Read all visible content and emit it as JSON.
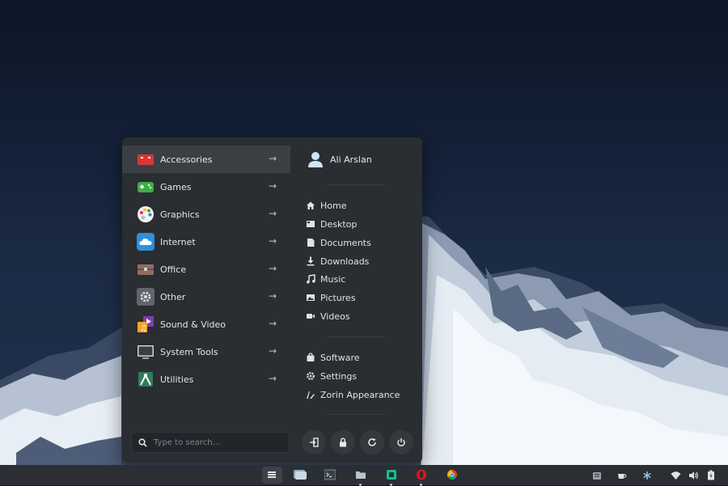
{
  "menu": {
    "categories": [
      {
        "label": "Accessories",
        "icon": "accessories-icon",
        "active": true
      },
      {
        "label": "Games",
        "icon": "games-icon"
      },
      {
        "label": "Graphics",
        "icon": "graphics-palette-icon"
      },
      {
        "label": "Internet",
        "icon": "internet-cloud-icon"
      },
      {
        "label": "Office",
        "icon": "office-briefcase-icon"
      },
      {
        "label": "Other",
        "icon": "gear-icon"
      },
      {
        "label": "Sound & Video",
        "icon": "sound-video-icon"
      },
      {
        "label": "System Tools",
        "icon": "monitor-icon"
      },
      {
        "label": "Utilities",
        "icon": "utilities-icon"
      }
    ],
    "search_placeholder": "Type to search...",
    "user": {
      "name": "Ali Arslan",
      "icon": "user-icon"
    },
    "places": [
      {
        "label": "Home",
        "icon": "home-icon"
      },
      {
        "label": "Desktop",
        "icon": "desktop-icon"
      },
      {
        "label": "Documents",
        "icon": "document-icon"
      },
      {
        "label": "Downloads",
        "icon": "download-icon"
      },
      {
        "label": "Music",
        "icon": "music-note-icon"
      },
      {
        "label": "Pictures",
        "icon": "picture-icon"
      },
      {
        "label": "Videos",
        "icon": "video-camera-icon"
      }
    ],
    "system": [
      {
        "label": "Software",
        "icon": "software-bag-icon"
      },
      {
        "label": "Settings",
        "icon": "gear-icon"
      },
      {
        "label": "Zorin Appearance",
        "icon": "zorin-appearance-icon"
      }
    ],
    "power_buttons": [
      "logout-icon",
      "lock-icon",
      "restart-icon",
      "power-icon"
    ]
  },
  "taskbar": {
    "apps": [
      "zorin-menu-icon",
      "files-window-icon",
      "terminal-icon",
      "file-manager-icon",
      "software-store-icon",
      "opera-icon",
      "chrome-icon"
    ],
    "tray": [
      "clipboard-icon",
      "coffee-icon",
      "settings-snowflake-icon",
      "wifi-icon",
      "volume-icon",
      "battery-icon"
    ]
  },
  "colors": {
    "menu_bg": "#2a2d31",
    "active_bg": "#3b3f44",
    "taskbar_bg": "#2b2f33",
    "accent_blue": "#4aa3df"
  }
}
